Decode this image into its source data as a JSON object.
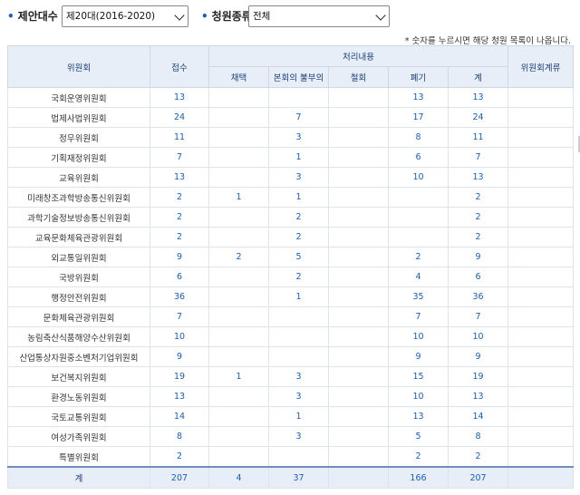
{
  "filters": {
    "era_label": "제안대수",
    "era_value": "제20대(2016-2020)",
    "type_label": "청원종류",
    "type_value": "전체"
  },
  "note": "* 숫자를 누르시면 해당 청원 목록이 나옵니다.",
  "headers": {
    "committee": "위원회",
    "received": "접수",
    "processing": "처리내용",
    "adopted": "채택",
    "not_submitted": "본회의 불부의",
    "withdrawn": "철회",
    "discarded": "폐기",
    "sum": "계",
    "transfer": "위원회계류"
  },
  "rows": [
    {
      "name": "국회운영위원회",
      "received": "13",
      "adopted": "",
      "not_submitted": "",
      "withdrawn": "",
      "discarded": "13",
      "sum": "13",
      "transfer": ""
    },
    {
      "name": "법제사법위원회",
      "received": "24",
      "adopted": "",
      "not_submitted": "7",
      "withdrawn": "",
      "discarded": "17",
      "sum": "24",
      "transfer": ""
    },
    {
      "name": "정무위원회",
      "received": "11",
      "adopted": "",
      "not_submitted": "3",
      "withdrawn": "",
      "discarded": "8",
      "sum": "11",
      "transfer": ""
    },
    {
      "name": "기획재정위원회",
      "received": "7",
      "adopted": "",
      "not_submitted": "1",
      "withdrawn": "",
      "discarded": "6",
      "sum": "7",
      "transfer": ""
    },
    {
      "name": "교육위원회",
      "received": "13",
      "adopted": "",
      "not_submitted": "3",
      "withdrawn": "",
      "discarded": "10",
      "sum": "13",
      "transfer": ""
    },
    {
      "name": "미래창조과학방송통신위원회",
      "received": "2",
      "adopted": "1",
      "not_submitted": "1",
      "withdrawn": "",
      "discarded": "",
      "sum": "2",
      "transfer": ""
    },
    {
      "name": "과학기술정보방송통신위원회",
      "received": "2",
      "adopted": "",
      "not_submitted": "2",
      "withdrawn": "",
      "discarded": "",
      "sum": "2",
      "transfer": ""
    },
    {
      "name": "교육문화체육관광위원회",
      "received": "2",
      "adopted": "",
      "not_submitted": "2",
      "withdrawn": "",
      "discarded": "",
      "sum": "2",
      "transfer": ""
    },
    {
      "name": "외교통일위원회",
      "received": "9",
      "adopted": "2",
      "not_submitted": "5",
      "withdrawn": "",
      "discarded": "2",
      "sum": "9",
      "transfer": ""
    },
    {
      "name": "국방위원회",
      "received": "6",
      "adopted": "",
      "not_submitted": "2",
      "withdrawn": "",
      "discarded": "4",
      "sum": "6",
      "transfer": ""
    },
    {
      "name": "행정안전위원회",
      "received": "36",
      "adopted": "",
      "not_submitted": "1",
      "withdrawn": "",
      "discarded": "35",
      "sum": "36",
      "transfer": ""
    },
    {
      "name": "문화체육관광위원회",
      "received": "7",
      "adopted": "",
      "not_submitted": "",
      "withdrawn": "",
      "discarded": "7",
      "sum": "7",
      "transfer": ""
    },
    {
      "name": "농림축산식품해양수산위원회",
      "received": "10",
      "adopted": "",
      "not_submitted": "",
      "withdrawn": "",
      "discarded": "10",
      "sum": "10",
      "transfer": ""
    },
    {
      "name": "산업통상자원중소벤처기업위원회",
      "received": "9",
      "adopted": "",
      "not_submitted": "",
      "withdrawn": "",
      "discarded": "9",
      "sum": "9",
      "transfer": ""
    },
    {
      "name": "보건복지위원회",
      "received": "19",
      "adopted": "1",
      "not_submitted": "3",
      "withdrawn": "",
      "discarded": "15",
      "sum": "19",
      "transfer": ""
    },
    {
      "name": "환경노동위원회",
      "received": "13",
      "adopted": "",
      "not_submitted": "3",
      "withdrawn": "",
      "discarded": "10",
      "sum": "13",
      "transfer": ""
    },
    {
      "name": "국토교통위원회",
      "received": "14",
      "adopted": "",
      "not_submitted": "1",
      "withdrawn": "",
      "discarded": "13",
      "sum": "14",
      "transfer": ""
    },
    {
      "name": "여성가족위원회",
      "received": "8",
      "adopted": "",
      "not_submitted": "3",
      "withdrawn": "",
      "discarded": "5",
      "sum": "8",
      "transfer": ""
    },
    {
      "name": "특별위원회",
      "received": "2",
      "adopted": "",
      "not_submitted": "",
      "withdrawn": "",
      "discarded": "2",
      "sum": "2",
      "transfer": ""
    }
  ],
  "total": {
    "name": "계",
    "received": "207",
    "adopted": "4",
    "not_submitted": "37",
    "withdrawn": "",
    "discarded": "166",
    "sum": "207",
    "transfer": ""
  }
}
